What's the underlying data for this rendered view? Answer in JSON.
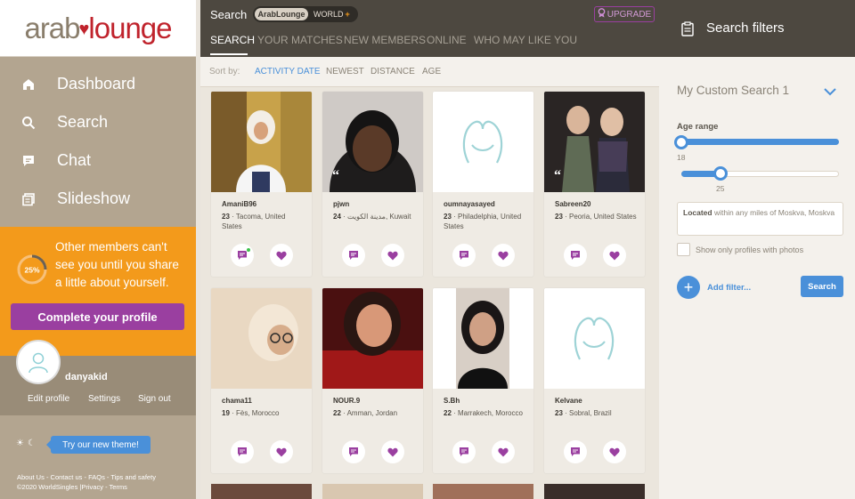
{
  "brand": {
    "logo_part1": "arab",
    "logo_part2": "lounge"
  },
  "colors": {
    "accent_orange": "#f39a1b",
    "accent_purple": "#9a3fa0",
    "accent_blue": "#4a90d9",
    "sidebar_bg": "#b3a590",
    "header_bg": "#4d4840"
  },
  "sidebar": {
    "nav": [
      {
        "label": "Dashboard",
        "icon": "home-icon"
      },
      {
        "label": "Search",
        "icon": "search-icon"
      },
      {
        "label": "Chat",
        "icon": "chat-icon"
      },
      {
        "label": "Slideshow",
        "icon": "slideshow-icon"
      }
    ],
    "profile_prompt": {
      "progress_text": "25%",
      "progress": 0.25,
      "message": "Other members can't see you until you share a little about yourself.",
      "cta": "Complete your profile"
    },
    "user": {
      "username": "danyakid",
      "links": [
        "Edit profile",
        "Settings",
        "Sign out"
      ]
    },
    "theme_button": "Try our new theme!",
    "footer": {
      "links": [
        "About Us",
        "Contact us",
        "FAQs",
        "Tips and safety"
      ],
      "copyright": "©2020 WorldSingles",
      "legal": [
        "Privacy",
        "Terms"
      ]
    }
  },
  "header": {
    "search_label": "Search",
    "toggle": {
      "active": "ArabLounge",
      "inactive": "WORLD",
      "inactive_suffix": "+"
    },
    "upgrade": "UPGRADE",
    "tabs": [
      "SEARCH",
      "YOUR MATCHES",
      "NEW MEMBERS",
      "ONLINE",
      "WHO MAY LIKE YOU"
    ]
  },
  "sort": {
    "label": "Sort by:",
    "options": [
      "ACTIVITY DATE",
      "NEWEST",
      "DISTANCE",
      "AGE"
    ]
  },
  "profiles": [
    {
      "name": "AmaniB96",
      "age": "23",
      "location": "Tacoma, United States"
    },
    {
      "name": "pjwn",
      "age": "24",
      "location": "مدينة الكويت, Kuwait"
    },
    {
      "name": "oumnayasayed",
      "age": "23",
      "location": "Philadelphia, United States"
    },
    {
      "name": "Sabreen20",
      "age": "23",
      "location": "Peoria, United States"
    },
    {
      "name": "chama11",
      "age": "19",
      "location": "Fès, Morocco"
    },
    {
      "name": "NOUR.9",
      "age": "22",
      "location": "Amman, Jordan"
    },
    {
      "name": "S.Bh",
      "age": "22",
      "location": "Marrakech, Morocco"
    },
    {
      "name": "Kelvane",
      "age": "23",
      "location": "Sobral, Brazil"
    }
  ],
  "filters": {
    "title": "Search filters",
    "custom_search": "My Custom Search 1",
    "age_label": "Age range",
    "age_min": "18",
    "age_max": "25",
    "location_bold": "Located",
    "location_text": " within any miles of Moskva, Moskva",
    "photos_only": "Show only profiles with photos",
    "add_filter": "Add filter...",
    "search_button": "Search"
  }
}
